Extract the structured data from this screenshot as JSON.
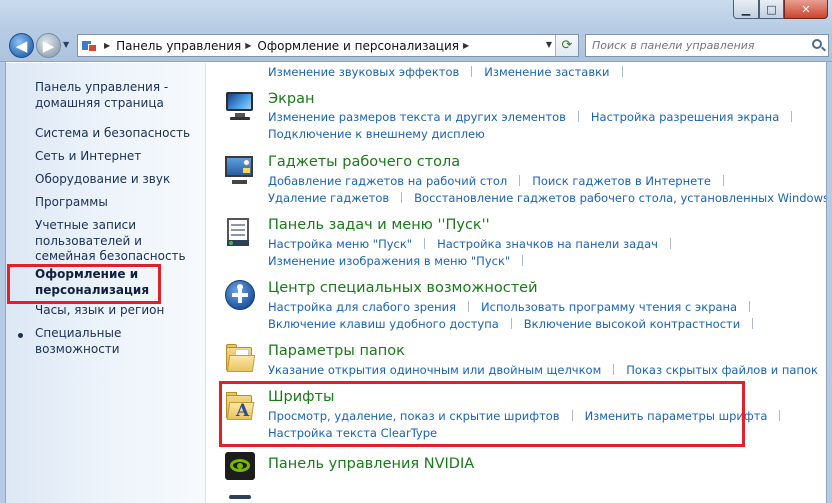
{
  "window": {
    "minimize_glyph": "▁",
    "maximize_glyph": "□",
    "close_glyph": "✕"
  },
  "toolbar": {
    "back_glyph": "◀",
    "forward_glyph": "▶",
    "history_glyph": "▼",
    "refresh_glyph": "⟳"
  },
  "address": {
    "crumbs": [
      "Панель управления",
      "Оформление и персонализация"
    ],
    "separator": "▶",
    "dropdown_glyph": "▼"
  },
  "search": {
    "placeholder": "Поиск в панели управления"
  },
  "sidebar": {
    "items": [
      {
        "label": "Панель управления - домашняя страница"
      },
      {
        "label": "Система и безопасность"
      },
      {
        "label": "Сеть и Интернет"
      },
      {
        "label": "Оборудование и звук"
      },
      {
        "label": "Программы"
      },
      {
        "label": "Учетные записи пользователей и семейная безопасность"
      },
      {
        "label": "Оформление и персонализация",
        "current": true
      },
      {
        "label": "Часы, язык и регион"
      },
      {
        "label": "Специальные возможности"
      }
    ]
  },
  "content": {
    "top_links": [
      "Изменение звуковых эффектов",
      "Изменение заставки"
    ],
    "categories": [
      {
        "title": "Экран",
        "icon": "display-icon",
        "links_row1": [
          "Изменение размеров текста и других элементов",
          "Настройка разрешения экрана"
        ],
        "links_row2": [
          "Подключение к внешнему дисплею"
        ]
      },
      {
        "title": "Гаджеты рабочего стола",
        "icon": "desktop-gadgets-icon",
        "links_row1": [
          "Добавление гаджетов на рабочий стол",
          "Поиск гаджетов в Интернете"
        ],
        "links_row2": [
          "Удаление гаджетов",
          "Восстановление гаджетов рабочего стола, установленных Windows"
        ]
      },
      {
        "title": "Панель задач и меню ''Пуск''",
        "icon": "taskbar-icon",
        "links_row1": [
          "Настройка меню \"Пуск\"",
          "Настройка значков на панели задач"
        ],
        "links_row2": [
          "Изменение изображения в меню \"Пуск\""
        ]
      },
      {
        "title": "Центр специальных возможностей",
        "icon": "ease-of-access-icon",
        "links_row1": [
          "Настройка для слабого зрения",
          "Использовать программу чтения с экрана"
        ],
        "links_row2": [
          "Включение клавиш удобного доступа",
          "Включение высокой контрастности"
        ]
      },
      {
        "title": "Параметры папок",
        "icon": "folder-options-icon",
        "links_row1": [
          "Указание открытия одиночным или двойным щелчком",
          "Показ скрытых файлов и папок"
        ]
      },
      {
        "title": "Шрифты",
        "icon": "fonts-icon",
        "links_row1": [
          "Просмотр, удаление, показ и скрытие шрифтов",
          "Изменить параметры шрифта"
        ],
        "links_row2": [
          "Настройка текста ClearType"
        ]
      },
      {
        "title": "Панель управления NVIDIA",
        "icon": "nvidia-icon"
      }
    ]
  },
  "highlight_color": "#e0212a"
}
